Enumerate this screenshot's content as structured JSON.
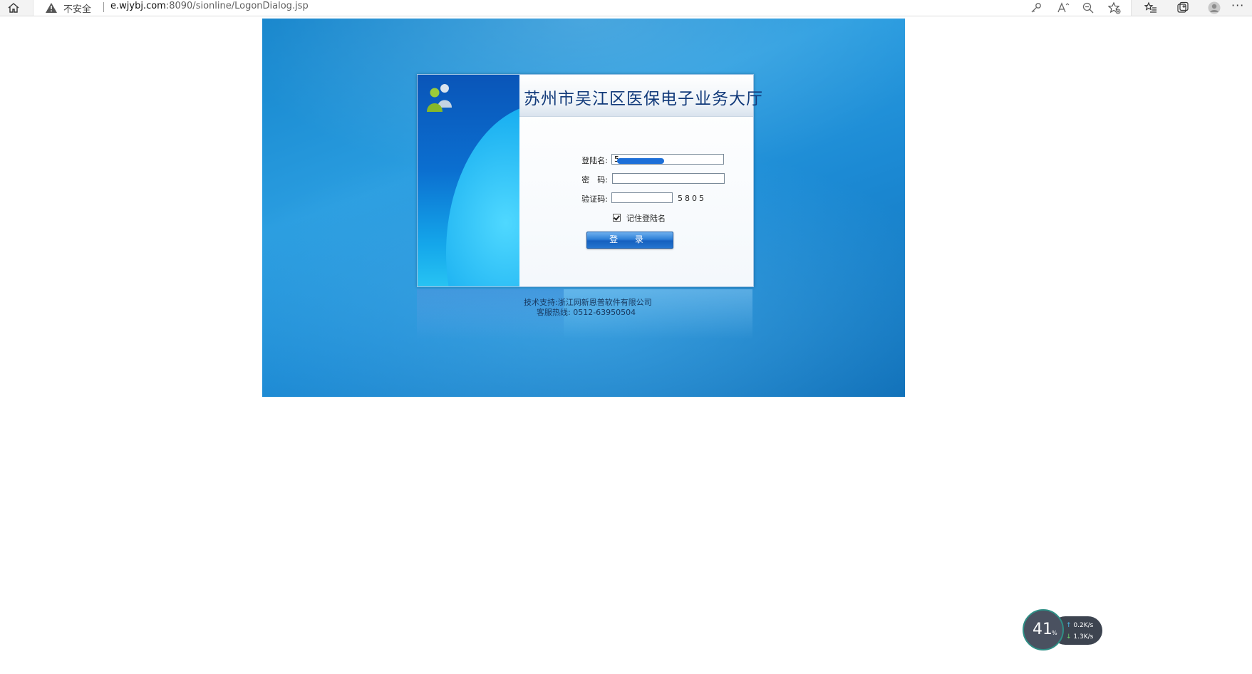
{
  "browser": {
    "security_label": "不安全",
    "url_host": "e.wjybj.com",
    "url_rest": ":8090/sionline/LogonDialog.jsp",
    "more_label": "···"
  },
  "login": {
    "title": "苏州市吴江区医保电子业务大厅",
    "username_label": "登陆名:",
    "username_value": "5",
    "password_label": "密　码:",
    "password_value": "",
    "captcha_label": "验证码:",
    "captcha_value": "",
    "captcha_code": "5805",
    "remember_label": "记住登陆名",
    "remember_checked": true,
    "login_button": "登 录"
  },
  "footer": {
    "support": "技术支持:浙江网新恩普软件有限公司",
    "hotline": "客服热线:  0512-63950504"
  },
  "speed_widget": {
    "percent": "41",
    "percent_unit": "%",
    "upload": "0.2",
    "download": "1.3",
    "rate_unit": "K/s"
  },
  "colors": {
    "page_blue": "#1c8ad4",
    "title_text": "#123a7a",
    "button_blue": "#1560bf"
  }
}
